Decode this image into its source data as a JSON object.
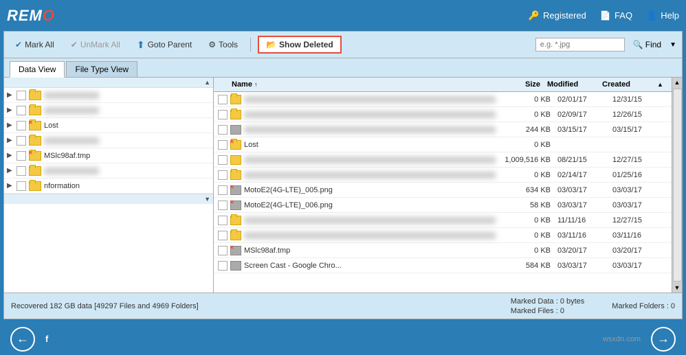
{
  "app": {
    "title": "remo",
    "title_accent": "O"
  },
  "header": {
    "registered_label": "Registered",
    "faq_label": "FAQ",
    "help_label": "Help"
  },
  "toolbar": {
    "mark_all": "Mark All",
    "unmark_all": "UnMark All",
    "goto_parent": "Goto Parent",
    "tools": "Tools",
    "show_deleted": "Show Deleted",
    "search_placeholder": "e.g. *.jpg",
    "find": "Find"
  },
  "tabs": [
    {
      "id": "data-view",
      "label": "Data View",
      "active": true
    },
    {
      "id": "file-type-view",
      "label": "File Type View",
      "active": false
    }
  ],
  "table_headers": {
    "name": "Name",
    "sort_indicator": "↑",
    "size": "Size",
    "modified": "Modified",
    "created": "Created"
  },
  "tree_items": [
    {
      "indent": 0,
      "label": "",
      "blurred": true
    },
    {
      "indent": 0,
      "label": "",
      "blurred": true
    },
    {
      "indent": 0,
      "label": "Lost",
      "has_x": true
    },
    {
      "indent": 0,
      "label": "",
      "blurred": true
    },
    {
      "indent": 0,
      "label": "MSlc98af.tmp",
      "has_x": true
    },
    {
      "indent": 0,
      "label": "",
      "blurred": true
    },
    {
      "indent": 0,
      "label": "nformation"
    }
  ],
  "file_rows": [
    {
      "name": "",
      "blurred": true,
      "size": "0 KB",
      "modified": "02/01/17",
      "created": "12/31/15",
      "is_folder": true,
      "has_x": false
    },
    {
      "name": "",
      "blurred": true,
      "size": "0 KB",
      "modified": "02/09/17",
      "created": "12/26/15",
      "is_folder": true,
      "has_x": false
    },
    {
      "name": "",
      "blurred": true,
      "size": "244 KB",
      "modified": "03/15/17",
      "created": "03/15/17",
      "is_folder": false,
      "has_x": false
    },
    {
      "name": "Lost",
      "blurred": false,
      "size": "0 KB",
      "modified": "",
      "created": "",
      "is_folder": true,
      "has_x": true
    },
    {
      "name": "",
      "blurred": true,
      "size": "1,009,516 KB",
      "modified": "08/21/15",
      "created": "12/27/15",
      "is_folder": false,
      "has_x": false
    },
    {
      "name": "",
      "blurred": true,
      "size": "0 KB",
      "modified": "02/14/17",
      "created": "01/25/16",
      "is_folder": true,
      "has_x": false
    },
    {
      "name": "MotoE2(4G-LTE)_005.png",
      "blurred": false,
      "size": "634 KB",
      "modified": "03/03/17",
      "created": "03/03/17",
      "is_folder": false,
      "has_x": true
    },
    {
      "name": "MotoE2(4G-LTE)_006.png",
      "blurred": false,
      "size": "58 KB",
      "modified": "03/03/17",
      "created": "03/03/17",
      "is_folder": false,
      "has_x": true
    },
    {
      "name": "",
      "blurred": true,
      "size": "0 KB",
      "modified": "11/11/16",
      "created": "12/27/15",
      "is_folder": true,
      "has_x": false
    },
    {
      "name": "",
      "blurred": true,
      "size": "0 KB",
      "modified": "03/11/16",
      "created": "03/11/16",
      "is_folder": true,
      "has_x": false
    },
    {
      "name": "MSlc98af.tmp",
      "blurred": false,
      "size": "0 KB",
      "modified": "03/20/17",
      "created": "03/20/17",
      "is_folder": false,
      "has_x": true
    },
    {
      "name": "Screen Cast - Google Chro...",
      "blurred": false,
      "size": "584 KB",
      "modified": "03/03/17",
      "created": "03/03/17",
      "is_folder": false,
      "has_x": false
    }
  ],
  "status": {
    "recovery_info": "Recovered 182 GB data [49297 Files and 4969 Folders]",
    "marked_data": "Marked Data : 0 bytes",
    "marked_files": "Marked Files : 0",
    "marked_folders": "Marked Folders : 0"
  },
  "bottom": {
    "wsxdn": "wsxdn.com"
  }
}
